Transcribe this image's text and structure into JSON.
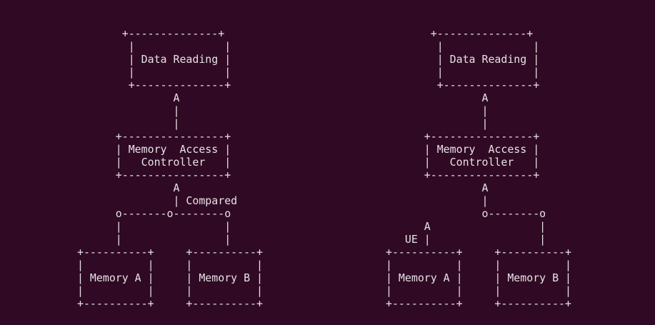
{
  "terminal": {
    "background": "#300a24",
    "foreground": "#e8e2e6"
  },
  "diagrams": {
    "left": "        +--------------+\n        |              |\n        | Data Reading |\n        |              |\n        +--------------+\n               A\n               |\n               |\n      +----------------+\n      | Memory  Access |\n      |   Controller   |\n      +----------------+\n               A\n               | Compared\n      o-------o--------o\n      |                |\n      |                |\n+----------+     +----------+\n|          |     |          |\n| Memory A |     | Memory B |\n|          |     |          |\n+----------+     +----------+",
    "right": "        +--------------+\n        |              |\n        | Data Reading |\n        |              |\n        +--------------+\n               A\n               |\n               |\n      +----------------+\n      | Memory  Access |\n      |   Controller   |\n      +----------------+\n               A\n               |\n               o--------o\n      A                 |\n   UE |                 |\n+----------+     +----------+\n|          |     |          |\n| Memory A |     | Memory B |\n|          |     |          |\n+----------+     +----------+"
  }
}
